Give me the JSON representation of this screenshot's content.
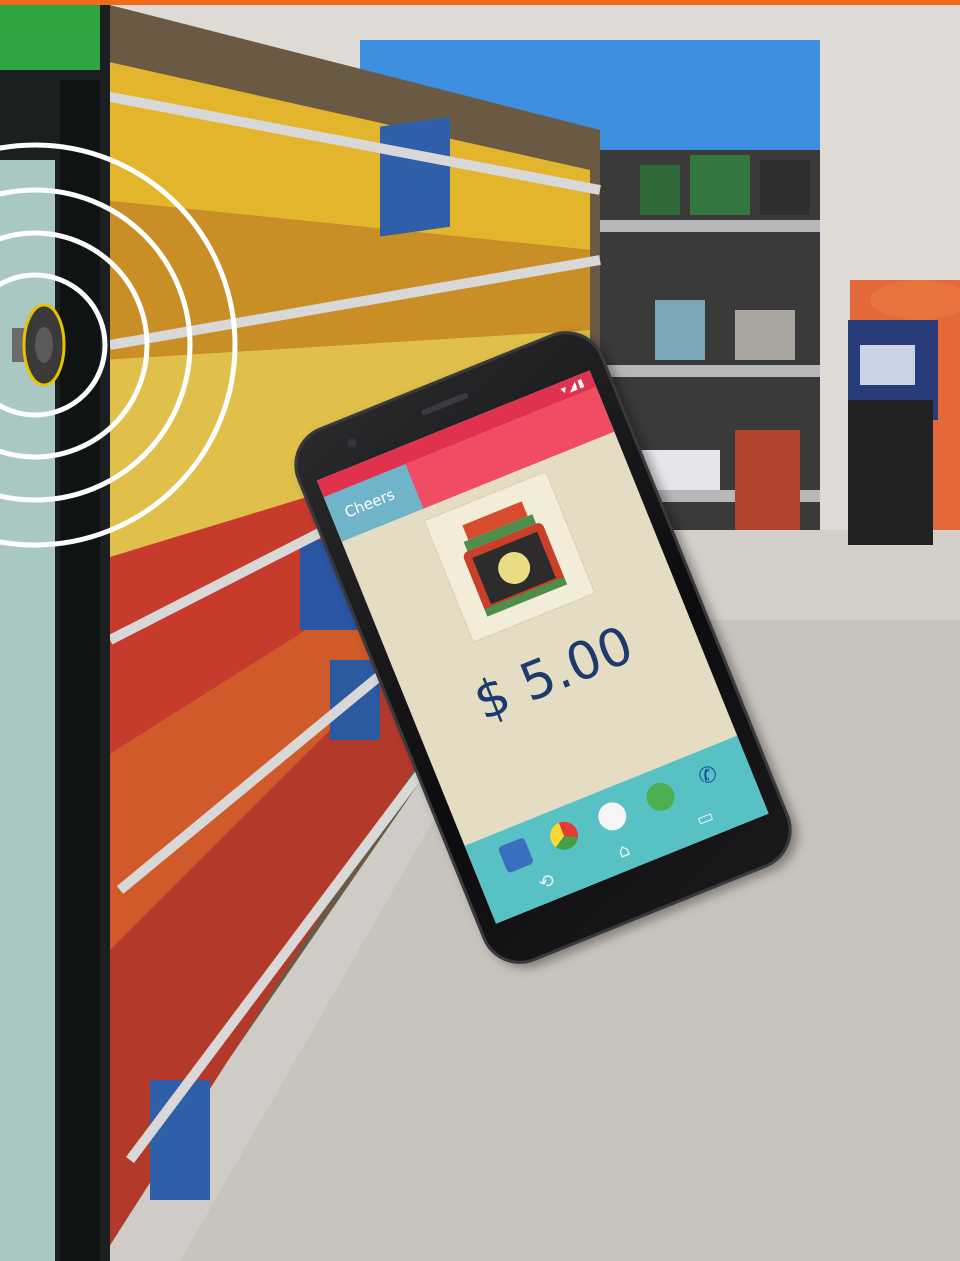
{
  "phone": {
    "app_title": "Cheers",
    "price": "$ 5.00",
    "status_icons": "▾◢▮"
  },
  "icons": [
    "speaker-icon",
    "sound-wave-icon",
    "chrome-icon",
    "apps-icon",
    "hangouts-icon",
    "phone-call-icon",
    "back-icon",
    "home-icon",
    "recents-icon",
    "jar-icon"
  ],
  "colors": {
    "accent_orange": "#f26a1b",
    "phone_status_red": "#e0314f",
    "phone_header_teal": "#6fb4c8",
    "phone_dock_teal": "#57c1c4",
    "price_text": "#1c3a6b"
  }
}
